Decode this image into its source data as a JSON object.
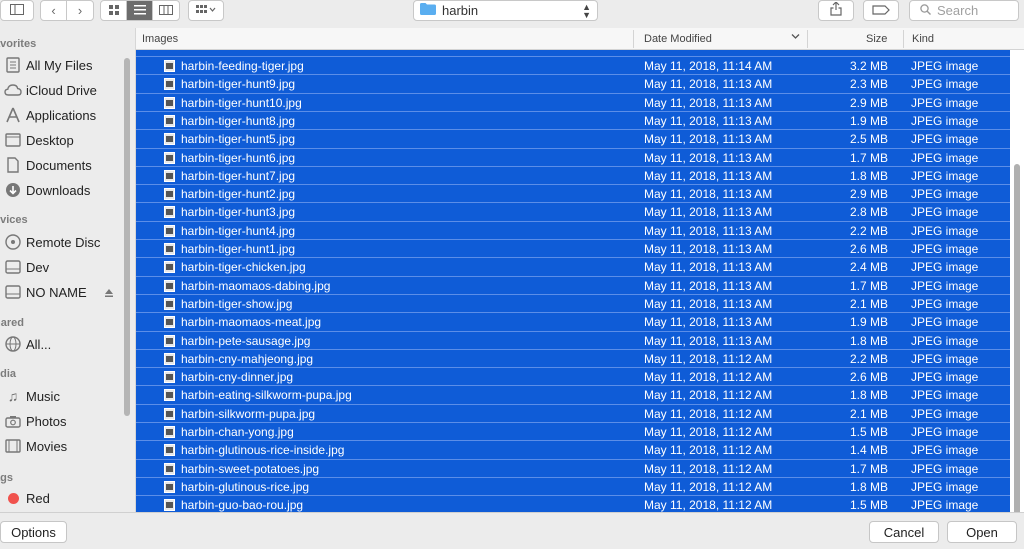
{
  "toolbar": {
    "path_label": "harbin",
    "search_placeholder": "Search"
  },
  "sidebar": {
    "favorites_header": "avorites",
    "favorites": [
      {
        "label": "All My Files",
        "icon": "all-files-icon"
      },
      {
        "label": "iCloud Drive",
        "icon": "cloud-icon"
      },
      {
        "label": "Applications",
        "icon": "applications-icon"
      },
      {
        "label": "Desktop",
        "icon": "desktop-icon"
      },
      {
        "label": "Documents",
        "icon": "documents-icon"
      },
      {
        "label": "Downloads",
        "icon": "downloads-icon"
      }
    ],
    "devices_header": "evices",
    "devices": [
      {
        "label": "Remote Disc",
        "icon": "disc-icon"
      },
      {
        "label": "Dev",
        "icon": "drive-icon"
      },
      {
        "label": "NO NAME",
        "icon": "drive-icon"
      }
    ],
    "shared_header": "hared",
    "shared": [
      {
        "label": "All...",
        "icon": "network-icon"
      }
    ],
    "media_header": "edia",
    "media": [
      {
        "label": "Music",
        "icon": "music-icon"
      },
      {
        "label": "Photos",
        "icon": "camera-icon"
      },
      {
        "label": "Movies",
        "icon": "film-icon"
      }
    ],
    "tags_header": "ags",
    "tags": [
      {
        "label": "Red",
        "color": "#f0524d"
      }
    ]
  },
  "list": {
    "headers": {
      "name": "Images",
      "date": "Date Modified",
      "size": "Size",
      "kind": "Kind"
    },
    "files": [
      {
        "name": "harbin-feeding-tiger.jpg",
        "date": "May 11, 2018, 11:14 AM",
        "size": "3.2 MB",
        "kind": "JPEG image"
      },
      {
        "name": "harbin-tiger-hunt9.jpg",
        "date": "May 11, 2018, 11:13 AM",
        "size": "2.3 MB",
        "kind": "JPEG image"
      },
      {
        "name": "harbin-tiger-hunt10.jpg",
        "date": "May 11, 2018, 11:13 AM",
        "size": "2.9 MB",
        "kind": "JPEG image"
      },
      {
        "name": "harbin-tiger-hunt8.jpg",
        "date": "May 11, 2018, 11:13 AM",
        "size": "1.9 MB",
        "kind": "JPEG image"
      },
      {
        "name": "harbin-tiger-hunt5.jpg",
        "date": "May 11, 2018, 11:13 AM",
        "size": "2.5 MB",
        "kind": "JPEG image"
      },
      {
        "name": "harbin-tiger-hunt6.jpg",
        "date": "May 11, 2018, 11:13 AM",
        "size": "1.7 MB",
        "kind": "JPEG image"
      },
      {
        "name": "harbin-tiger-hunt7.jpg",
        "date": "May 11, 2018, 11:13 AM",
        "size": "1.8 MB",
        "kind": "JPEG image"
      },
      {
        "name": "harbin-tiger-hunt2.jpg",
        "date": "May 11, 2018, 11:13 AM",
        "size": "2.9 MB",
        "kind": "JPEG image"
      },
      {
        "name": "harbin-tiger-hunt3.jpg",
        "date": "May 11, 2018, 11:13 AM",
        "size": "2.8 MB",
        "kind": "JPEG image"
      },
      {
        "name": "harbin-tiger-hunt4.jpg",
        "date": "May 11, 2018, 11:13 AM",
        "size": "2.2 MB",
        "kind": "JPEG image"
      },
      {
        "name": "harbin-tiger-hunt1.jpg",
        "date": "May 11, 2018, 11:13 AM",
        "size": "2.6 MB",
        "kind": "JPEG image"
      },
      {
        "name": "harbin-tiger-chicken.jpg",
        "date": "May 11, 2018, 11:13 AM",
        "size": "2.4 MB",
        "kind": "JPEG image"
      },
      {
        "name": "harbin-maomaos-dabing.jpg",
        "date": "May 11, 2018, 11:13 AM",
        "size": "1.7 MB",
        "kind": "JPEG image"
      },
      {
        "name": "harbin-tiger-show.jpg",
        "date": "May 11, 2018, 11:13 AM",
        "size": "2.1 MB",
        "kind": "JPEG image"
      },
      {
        "name": "harbin-maomaos-meat.jpg",
        "date": "May 11, 2018, 11:13 AM",
        "size": "1.9 MB",
        "kind": "JPEG image"
      },
      {
        "name": "harbin-pete-sausage.jpg",
        "date": "May 11, 2018, 11:13 AM",
        "size": "1.8 MB",
        "kind": "JPEG image"
      },
      {
        "name": "harbin-cny-mahjeong.jpg",
        "date": "May 11, 2018, 11:12 AM",
        "size": "2.2 MB",
        "kind": "JPEG image"
      },
      {
        "name": "harbin-cny-dinner.jpg",
        "date": "May 11, 2018, 11:12 AM",
        "size": "2.6 MB",
        "kind": "JPEG image"
      },
      {
        "name": "harbin-eating-silkworm-pupa.jpg",
        "date": "May 11, 2018, 11:12 AM",
        "size": "1.8 MB",
        "kind": "JPEG image"
      },
      {
        "name": "harbin-silkworm-pupa.jpg",
        "date": "May 11, 2018, 11:12 AM",
        "size": "2.1 MB",
        "kind": "JPEG image"
      },
      {
        "name": "harbin-chan-yong.jpg",
        "date": "May 11, 2018, 11:12 AM",
        "size": "1.5 MB",
        "kind": "JPEG image"
      },
      {
        "name": "harbin-glutinous-rice-inside.jpg",
        "date": "May 11, 2018, 11:12 AM",
        "size": "1.4 MB",
        "kind": "JPEG image"
      },
      {
        "name": "harbin-sweet-potatoes.jpg",
        "date": "May 11, 2018, 11:12 AM",
        "size": "1.7 MB",
        "kind": "JPEG image"
      },
      {
        "name": "harbin-glutinous-rice.jpg",
        "date": "May 11, 2018, 11:12 AM",
        "size": "1.8 MB",
        "kind": "JPEG image"
      },
      {
        "name": "harbin-guo-bao-rou.jpg",
        "date": "May 11, 2018, 11:12 AM",
        "size": "1.5 MB",
        "kind": "JPEG image"
      }
    ]
  },
  "bottom": {
    "options_label": "Options",
    "cancel_label": "Cancel",
    "open_label": "Open"
  }
}
